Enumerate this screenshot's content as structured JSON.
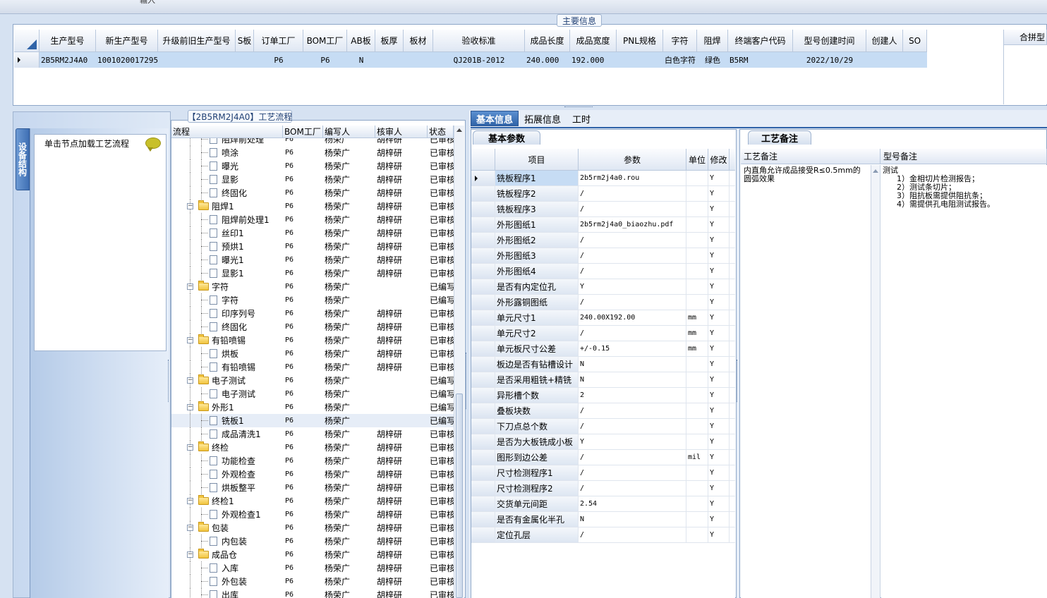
{
  "top_strip_label": "输入",
  "main_info": {
    "group_label": "主要信息",
    "columns": [
      "生产型号",
      "新生产型号",
      "升级前旧生产型号",
      "S板",
      "订单工厂",
      "BOM工厂",
      "AB板",
      "板厚",
      "板材",
      "验收标准",
      "成品长度",
      "成品宽度",
      "PNL规格",
      "字符",
      "阻焊",
      "终端客户代码",
      "型号创建时间",
      "创建人",
      "SO"
    ],
    "row": [
      "2B5RM2J4A0",
      "10010200172957",
      "",
      "",
      "P6",
      "P6",
      "N",
      "",
      "",
      "QJ201B-2012",
      "240.000",
      "192.000",
      "",
      "白色字符",
      "绿色",
      "B5RM",
      "2022/10/29",
      "",
      ""
    ],
    "right_panel_label": "合拼型"
  },
  "left_panel": {
    "vertical_tab": "设备结构",
    "hint_text": "单击节点加载工艺流程"
  },
  "process_flow": {
    "group_label": "【2B5RM2J4A0】工艺流程",
    "columns": [
      "流程",
      "BOM工厂",
      "编写人",
      "核审人",
      "状态"
    ],
    "rows": [
      {
        "level": 2,
        "name": "阻焊前处理",
        "bom": "P6",
        "writer": "杨荣广",
        "reviewer": "胡梓研",
        "status": "已审核"
      },
      {
        "level": 2,
        "name": "喷涂",
        "bom": "P6",
        "writer": "杨荣广",
        "reviewer": "胡梓研",
        "status": "已审核"
      },
      {
        "level": 2,
        "name": "曝光",
        "bom": "P6",
        "writer": "杨荣广",
        "reviewer": "胡梓研",
        "status": "已审核"
      },
      {
        "level": 2,
        "name": "显影",
        "bom": "P6",
        "writer": "杨荣广",
        "reviewer": "胡梓研",
        "status": "已审核"
      },
      {
        "level": 2,
        "name": "终固化",
        "bom": "P6",
        "writer": "杨荣广",
        "reviewer": "胡梓研",
        "status": "已审核"
      },
      {
        "level": 1,
        "name": "阻焊1",
        "bom": "P6",
        "writer": "杨荣广",
        "reviewer": "胡梓研",
        "status": "已审核"
      },
      {
        "level": 2,
        "name": "阻焊前处理1",
        "bom": "P6",
        "writer": "杨荣广",
        "reviewer": "胡梓研",
        "status": "已审核"
      },
      {
        "level": 2,
        "name": "丝印1",
        "bom": "P6",
        "writer": "杨荣广",
        "reviewer": "胡梓研",
        "status": "已审核"
      },
      {
        "level": 2,
        "name": "预烘1",
        "bom": "P6",
        "writer": "杨荣广",
        "reviewer": "胡梓研",
        "status": "已审核"
      },
      {
        "level": 2,
        "name": "曝光1",
        "bom": "P6",
        "writer": "杨荣广",
        "reviewer": "胡梓研",
        "status": "已审核"
      },
      {
        "level": 2,
        "name": "显影1",
        "bom": "P6",
        "writer": "杨荣广",
        "reviewer": "胡梓研",
        "status": "已审核"
      },
      {
        "level": 1,
        "name": "字符",
        "bom": "P6",
        "writer": "杨荣广",
        "reviewer": "",
        "status": "已编写"
      },
      {
        "level": 2,
        "name": "字符",
        "bom": "P6",
        "writer": "杨荣广",
        "reviewer": "",
        "status": "已编写"
      },
      {
        "level": 2,
        "name": "印序列号",
        "bom": "P6",
        "writer": "杨荣广",
        "reviewer": "胡梓研",
        "status": "已审核"
      },
      {
        "level": 2,
        "name": "终固化",
        "bom": "P6",
        "writer": "杨荣广",
        "reviewer": "胡梓研",
        "status": "已审核"
      },
      {
        "level": 1,
        "name": "有铅喷锡",
        "bom": "P6",
        "writer": "杨荣广",
        "reviewer": "胡梓研",
        "status": "已审核"
      },
      {
        "level": 2,
        "name": "烘板",
        "bom": "P6",
        "writer": "杨荣广",
        "reviewer": "胡梓研",
        "status": "已审核"
      },
      {
        "level": 2,
        "name": "有铅喷锡",
        "bom": "P6",
        "writer": "杨荣广",
        "reviewer": "胡梓研",
        "status": "已审核"
      },
      {
        "level": 1,
        "name": "电子测试",
        "bom": "P6",
        "writer": "杨荣广",
        "reviewer": "",
        "status": "已编写"
      },
      {
        "level": 2,
        "name": "电子测试",
        "bom": "P6",
        "writer": "杨荣广",
        "reviewer": "",
        "status": "已编写"
      },
      {
        "level": 1,
        "name": "外形1",
        "bom": "P6",
        "writer": "杨荣广",
        "reviewer": "",
        "status": "已编写"
      },
      {
        "level": 2,
        "name": "铣板1",
        "bom": "P6",
        "writer": "杨荣广",
        "reviewer": "",
        "status": "已编写"
      },
      {
        "level": 2,
        "name": "成品清洗1",
        "bom": "P6",
        "writer": "杨荣广",
        "reviewer": "胡梓研",
        "status": "已审核"
      },
      {
        "level": 1,
        "name": "终检",
        "bom": "P6",
        "writer": "杨荣广",
        "reviewer": "胡梓研",
        "status": "已审核"
      },
      {
        "level": 2,
        "name": "功能检查",
        "bom": "P6",
        "writer": "杨荣广",
        "reviewer": "胡梓研",
        "status": "已审核"
      },
      {
        "level": 2,
        "name": "外观检查",
        "bom": "P6",
        "writer": "杨荣广",
        "reviewer": "胡梓研",
        "status": "已审核"
      },
      {
        "level": 2,
        "name": "烘板整平",
        "bom": "P6",
        "writer": "杨荣广",
        "reviewer": "胡梓研",
        "status": "已审核"
      },
      {
        "level": 1,
        "name": "终检1",
        "bom": "P6",
        "writer": "杨荣广",
        "reviewer": "胡梓研",
        "status": "已审核"
      },
      {
        "level": 2,
        "name": "外观检查1",
        "bom": "P6",
        "writer": "杨荣广",
        "reviewer": "胡梓研",
        "status": "已审核"
      },
      {
        "level": 1,
        "name": "包装",
        "bom": "P6",
        "writer": "杨荣广",
        "reviewer": "胡梓研",
        "status": "已审核"
      },
      {
        "level": 2,
        "name": "内包装",
        "bom": "P6",
        "writer": "杨荣广",
        "reviewer": "胡梓研",
        "status": "已审核"
      },
      {
        "level": 1,
        "name": "成品仓",
        "bom": "P6",
        "writer": "杨荣广",
        "reviewer": "胡梓研",
        "status": "已审核"
      },
      {
        "level": 2,
        "name": "入库",
        "bom": "P6",
        "writer": "杨荣广",
        "reviewer": "胡梓研",
        "status": "已审核"
      },
      {
        "level": 2,
        "name": "外包装",
        "bom": "P6",
        "writer": "杨荣广",
        "reviewer": "胡梓研",
        "status": "已审核"
      },
      {
        "level": 2,
        "name": "出库",
        "bom": "P6",
        "writer": "杨荣广",
        "reviewer": "胡梓研",
        "status": "已审核"
      }
    ],
    "selected_index": 21
  },
  "right_tabs": [
    "基本信息",
    "拓展信息",
    "工时"
  ],
  "basic_params": {
    "group_label": "基本参数",
    "columns": [
      "项目",
      "参数",
      "单位",
      "修改"
    ],
    "rows": [
      {
        "item": "铣板程序1",
        "param": "2b5rm2j4a0.rou",
        "unit": "",
        "mod": "Y"
      },
      {
        "item": "铣板程序2",
        "param": "/",
        "unit": "",
        "mod": "Y"
      },
      {
        "item": "铣板程序3",
        "param": "/",
        "unit": "",
        "mod": "Y"
      },
      {
        "item": "外形图纸1",
        "param": "2b5rm2j4a0_biaozhu.pdf",
        "unit": "",
        "mod": "Y"
      },
      {
        "item": "外形图纸2",
        "param": "/",
        "unit": "",
        "mod": "Y"
      },
      {
        "item": "外形图纸3",
        "param": "/",
        "unit": "",
        "mod": "Y"
      },
      {
        "item": "外形图纸4",
        "param": "/",
        "unit": "",
        "mod": "Y"
      },
      {
        "item": "是否有内定位孔",
        "param": "Y",
        "unit": "",
        "mod": "Y"
      },
      {
        "item": "外形露铜图纸",
        "param": "/",
        "unit": "",
        "mod": "Y"
      },
      {
        "item": "单元尺寸1",
        "param": "240.00X192.00",
        "unit": "mm",
        "mod": "Y"
      },
      {
        "item": "单元尺寸2",
        "param": "/",
        "unit": "mm",
        "mod": "Y"
      },
      {
        "item": "单元板尺寸公差",
        "param": "+/-0.15",
        "unit": "mm",
        "mod": "Y"
      },
      {
        "item": "板边是否有钻槽设计",
        "param": "N",
        "unit": "",
        "mod": "Y"
      },
      {
        "item": "是否采用粗铣+精铣",
        "param": "N",
        "unit": "",
        "mod": "Y"
      },
      {
        "item": "异形槽个数",
        "param": "2",
        "unit": "",
        "mod": "Y"
      },
      {
        "item": "叠板块数",
        "param": "/",
        "unit": "",
        "mod": "Y"
      },
      {
        "item": "下刀点总个数",
        "param": "/",
        "unit": "",
        "mod": "Y"
      },
      {
        "item": "是否为大板铣成小板",
        "param": "Y",
        "unit": "",
        "mod": "Y"
      },
      {
        "item": "图形到边公差",
        "param": "/",
        "unit": "mil",
        "mod": "Y"
      },
      {
        "item": "尺寸检测程序1",
        "param": "/",
        "unit": "",
        "mod": "Y"
      },
      {
        "item": "尺寸检测程序2",
        "param": "/",
        "unit": "",
        "mod": "Y"
      },
      {
        "item": "交货单元间距",
        "param": "2.54",
        "unit": "",
        "mod": "Y"
      },
      {
        "item": "是否有金属化半孔",
        "param": "N",
        "unit": "",
        "mod": "Y"
      },
      {
        "item": "定位孔层",
        "param": "/",
        "unit": "",
        "mod": "Y"
      }
    ]
  },
  "remarks": {
    "group_label": "工艺备注",
    "col1_header": "工艺备注",
    "col2_header": "型号备注",
    "process_remark_lines": [
      "内直角允许成品接受R≤0.5mm的",
      "圆弧效果"
    ],
    "model_remark_lines": [
      "测试",
      "1）金相切片检测报告；",
      "2）测试条切片；",
      "3）阻抗板需提供阻抗条；",
      "4）需提供孔电阻测试报告。"
    ]
  }
}
